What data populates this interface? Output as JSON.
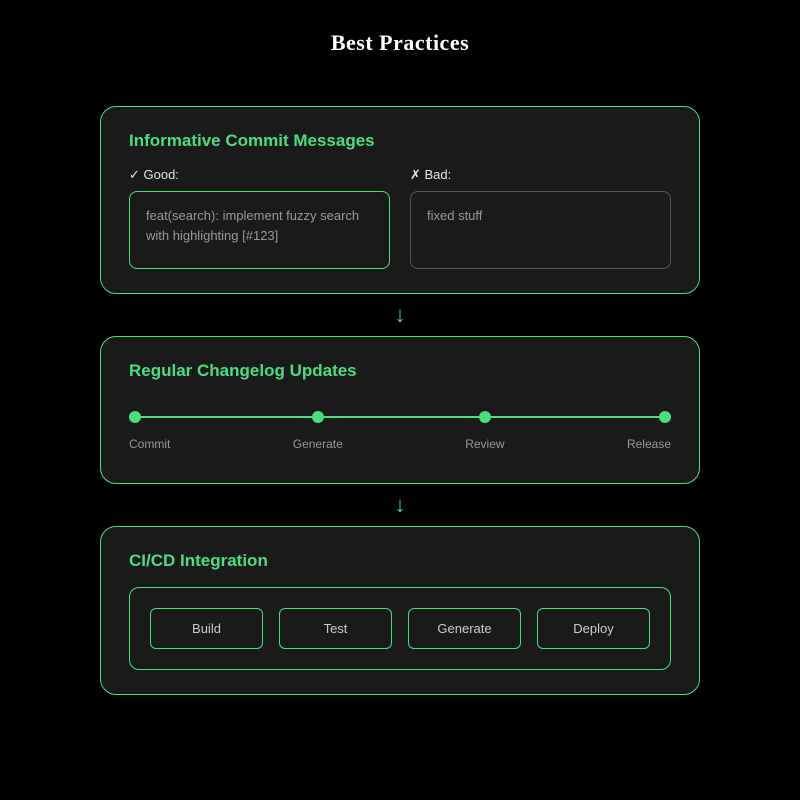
{
  "title": "Best Practices",
  "card1": {
    "title": "Informative Commit Messages",
    "good_label": "✓ Good:",
    "bad_label": "✗ Bad:",
    "good_example": "feat(search): implement fuzzy search with highlighting [#123]",
    "bad_example": "fixed stuff"
  },
  "card2": {
    "title": "Regular Changelog Updates",
    "steps": [
      "Commit",
      "Generate",
      "Review",
      "Release"
    ]
  },
  "card3": {
    "title": "CI/CD Integration",
    "stages": [
      "Build",
      "Test",
      "Generate",
      "Deploy"
    ]
  },
  "colors": {
    "accent": "#4ade80",
    "card_bg": "#1a1a1a",
    "page_bg": "#000000"
  }
}
